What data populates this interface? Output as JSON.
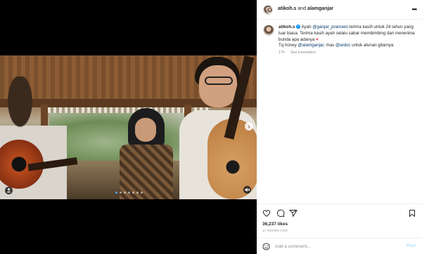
{
  "media": {
    "carousel_dots": 7,
    "active_dot": 0,
    "next_icon": "chevron-right-icon",
    "tag_icon": "user-tag-icon",
    "mute_icon": "muted-speaker-icon"
  },
  "header": {
    "user1": "atikoh.s",
    "connector": "and",
    "user2": "alamganjar",
    "more_icon": "more-horizontal-icon"
  },
  "caption": {
    "username": "atikoh.s",
    "text_1": "Ayah",
    "mention_1": "@ganjar_pranowo",
    "text_2": "terima kasih untuk 24 tahun yang luar biasa. Terima kasih ayah selalu sabar membimbing dan menerima bunda apa adanya",
    "heart": "♥",
    "text_3": "Tq honey",
    "mention_2": "@alamganjar",
    "text_4": ", mas",
    "mention_3": "@ardcc",
    "text_5": "untuk alunan gitarnya",
    "age": "17h",
    "see_translation": "See translation"
  },
  "actions": {
    "like_icon": "heart-icon",
    "comment_icon": "comment-icon",
    "share_icon": "send-icon",
    "save_icon": "bookmark-icon"
  },
  "likes": "36,237 likes",
  "timestamp": "17 HOURS AGO",
  "comment": {
    "placeholder": "Add a comment...",
    "post_label": "Post",
    "emoji_icon": "smiley-icon"
  },
  "colors": {
    "link": "#00376b",
    "verified": "#0095f6",
    "heart": "#ed4956",
    "post_disabled": "#b2dffc"
  }
}
